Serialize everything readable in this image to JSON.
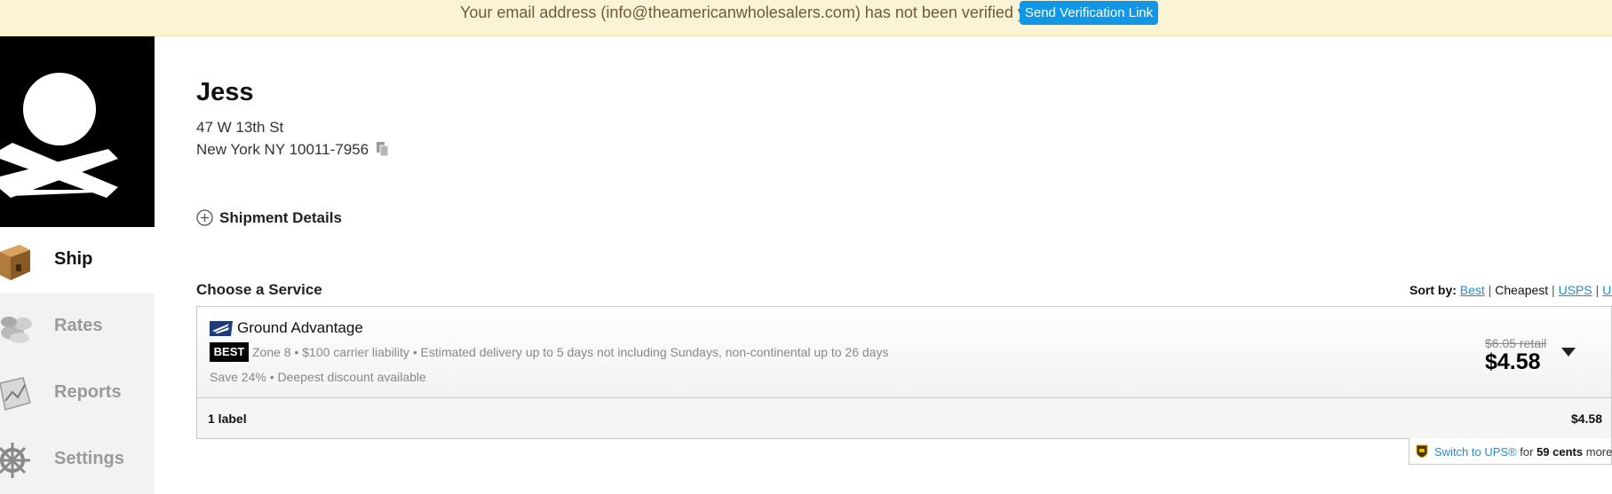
{
  "banner": {
    "message": "Your email address (info@theamericanwholesalers.com) has not been verified yet!",
    "button_label": "Send Verification Link",
    "button_color": "#1197e6"
  },
  "sidebar": {
    "logo_icon": "skull-crossbones-icon",
    "items": [
      {
        "label": "Ship",
        "icon": "package-icon",
        "active": true
      },
      {
        "label": "Rates",
        "icon": "coins-icon",
        "active": false
      },
      {
        "label": "Reports",
        "icon": "report-icon",
        "active": false
      },
      {
        "label": "Settings",
        "icon": "ship-wheel-icon",
        "active": false
      }
    ]
  },
  "recipient": {
    "name": "Jess",
    "address_line1": "47 W 13th St",
    "address_line2": "New York NY 10011-7956",
    "copy_icon": "clipboard-icon"
  },
  "shipment_details": {
    "label": "Shipment Details",
    "icon": "plus-circle-icon"
  },
  "service_section": {
    "title": "Choose a Service",
    "sort": {
      "label": "Sort by:",
      "options": [
        "Best",
        "Cheapest",
        "USPS",
        "UPS"
      ],
      "selected": "Cheapest"
    }
  },
  "service": {
    "carrier_icon": "usps-eagle-icon",
    "name": "Ground Advantage",
    "badge": "BEST",
    "info": "Zone 8 • $100 carrier liability • Estimated delivery up to 5 days not including Sundays, non-continental up to 26 days",
    "savings": "Save 24% • Deepest discount available",
    "retail_price": "$6.05 retail",
    "price": "$4.58"
  },
  "labels": {
    "count": "1 label",
    "total": "$4.58"
  },
  "switch": {
    "link": "Switch to UPS®",
    "mid": " for ",
    "amount": "59 cents",
    "tail": " more",
    "icon": "ups-shield-icon"
  }
}
